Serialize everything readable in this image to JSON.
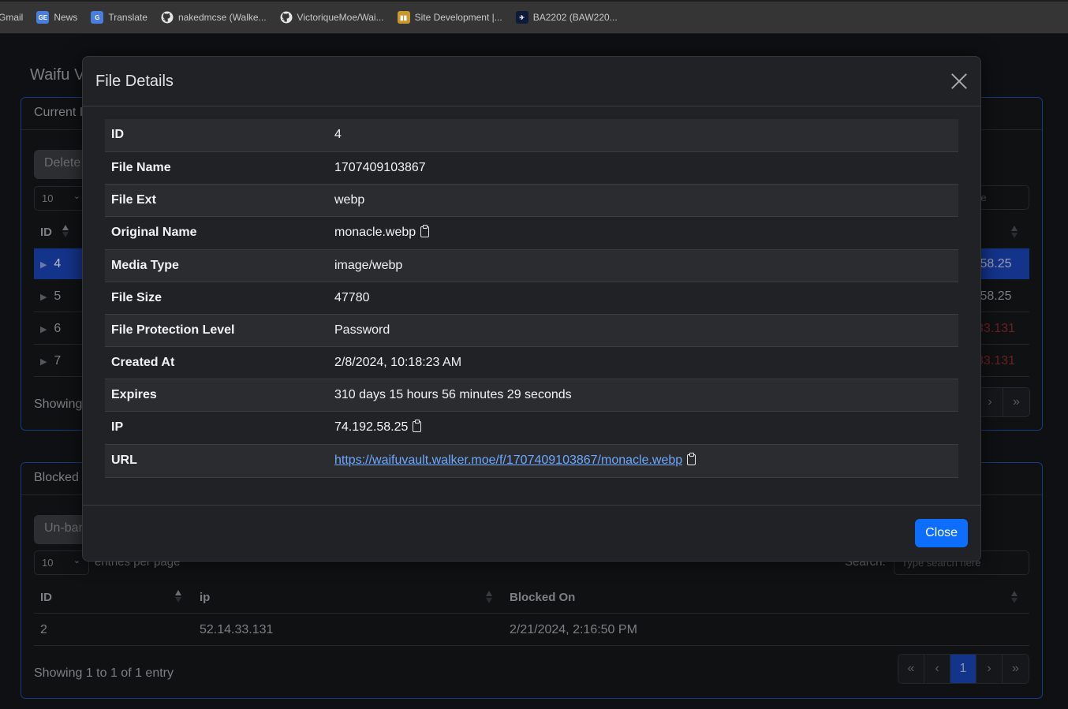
{
  "bookmarks": [
    {
      "label": "Gmail",
      "icon": "gmail-icon"
    },
    {
      "label": "News",
      "icon": "google-news-icon"
    },
    {
      "label": "Translate",
      "icon": "google-translate-icon"
    },
    {
      "label": "nakedmcse (Walke...",
      "icon": "github-icon"
    },
    {
      "label": "VictoriqueMoe/Wai...",
      "icon": "github-icon"
    },
    {
      "label": "Site Development |...",
      "icon": "trello-icon"
    },
    {
      "label": "BA2202 (BAW220...",
      "icon": "flight-icon"
    }
  ],
  "page": {
    "title": "Waifu V",
    "card1": {
      "header": "Current I",
      "delete_button": "Delete",
      "per_page_value": "10",
      "search_placeholder_tail": "re",
      "columns": [
        "ID"
      ],
      "rows": [
        {
          "id": "4",
          "ip_tail": ".58.25",
          "selected": true,
          "blocked": false
        },
        {
          "id": "5",
          "ip_tail": ".58.25",
          "selected": false,
          "blocked": false
        },
        {
          "id": "6",
          "ip_tail": "33.131",
          "selected": false,
          "blocked": true
        },
        {
          "id": "7",
          "ip_tail": "33.131",
          "selected": false,
          "blocked": true
        }
      ],
      "showing": "Showing",
      "pager": [
        "›",
        "»"
      ]
    },
    "card2": {
      "header": "Blocked",
      "unban_button": "Un-ban",
      "per_page_value": "10",
      "per_page_label": "entries per page",
      "search_label": "Search:",
      "search_placeholder": "Type search here",
      "columns": [
        "ID",
        "ip",
        "Blocked On"
      ],
      "rows": [
        {
          "id": "2",
          "ip": "52.14.33.131",
          "blocked_on": "2/21/2024, 2:16:50 PM"
        }
      ],
      "showing": "Showing 1 to 1 of 1 entry",
      "pager": [
        "«",
        "‹",
        "1",
        "›",
        "»"
      ],
      "active_page": "1"
    }
  },
  "modal": {
    "title": "File Details",
    "close_label": "Close",
    "rows": [
      {
        "key": "ID",
        "value": "4"
      },
      {
        "key": "File Name",
        "value": "1707409103867"
      },
      {
        "key": "File Ext",
        "value": "webp"
      },
      {
        "key": "Original Name",
        "value": "monacle.webp",
        "copy": true
      },
      {
        "key": "Media Type",
        "value": "image/webp"
      },
      {
        "key": "File Size",
        "value": "47780"
      },
      {
        "key": "File Protection Level",
        "value": "Password"
      },
      {
        "key": "Created At",
        "value": "2/8/2024, 10:18:23 AM"
      },
      {
        "key": "Expires",
        "value": "310 days 15 hours 56 minutes 29 seconds"
      },
      {
        "key": "IP",
        "value": "74.192.58.25",
        "copy": true
      },
      {
        "key": "URL",
        "value": "https://waifuvault.walker.moe/f/1707409103867/monacle.webp",
        "copy": true,
        "link": true
      }
    ]
  },
  "colors": {
    "accent": "#0d6efd",
    "selected_row": "#14338a",
    "link": "#6ea8fe",
    "card_border": "#173a80"
  }
}
